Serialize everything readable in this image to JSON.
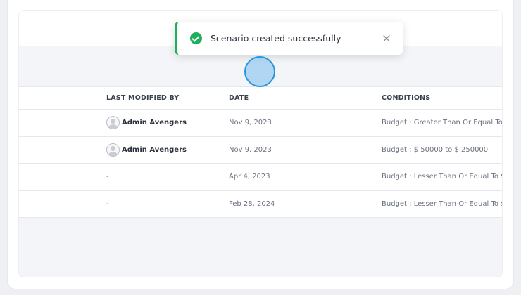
{
  "toast": {
    "message": "Scenario created successfully",
    "close_symbol": "×",
    "accent_color": "#1fae5b"
  },
  "table": {
    "headers": {
      "last_modified_by": "LAST MODIFIED BY",
      "date": "DATE",
      "conditions": "CONDITIONS"
    },
    "rows": [
      {
        "last_modified_by": "Admin Avengers",
        "date": "Nov 9, 2023",
        "conditions": "Budget : Greater Than Or Equal To $"
      },
      {
        "last_modified_by": "Admin Avengers",
        "date": "Nov 9, 2023",
        "conditions": "Budget : $ 50000 to $ 250000"
      },
      {
        "last_modified_by": "-",
        "date": "Apr 4, 2023",
        "conditions": "Budget : Lesser Than Or Equal To $"
      },
      {
        "last_modified_by": "-",
        "date": "Feb 28, 2024",
        "conditions": "Budget : Lesser Than Or Equal To $"
      }
    ]
  },
  "icons": {
    "toast_status": "check-circle-icon",
    "toast_close": "close-icon",
    "user": "user-avatar-icon"
  }
}
